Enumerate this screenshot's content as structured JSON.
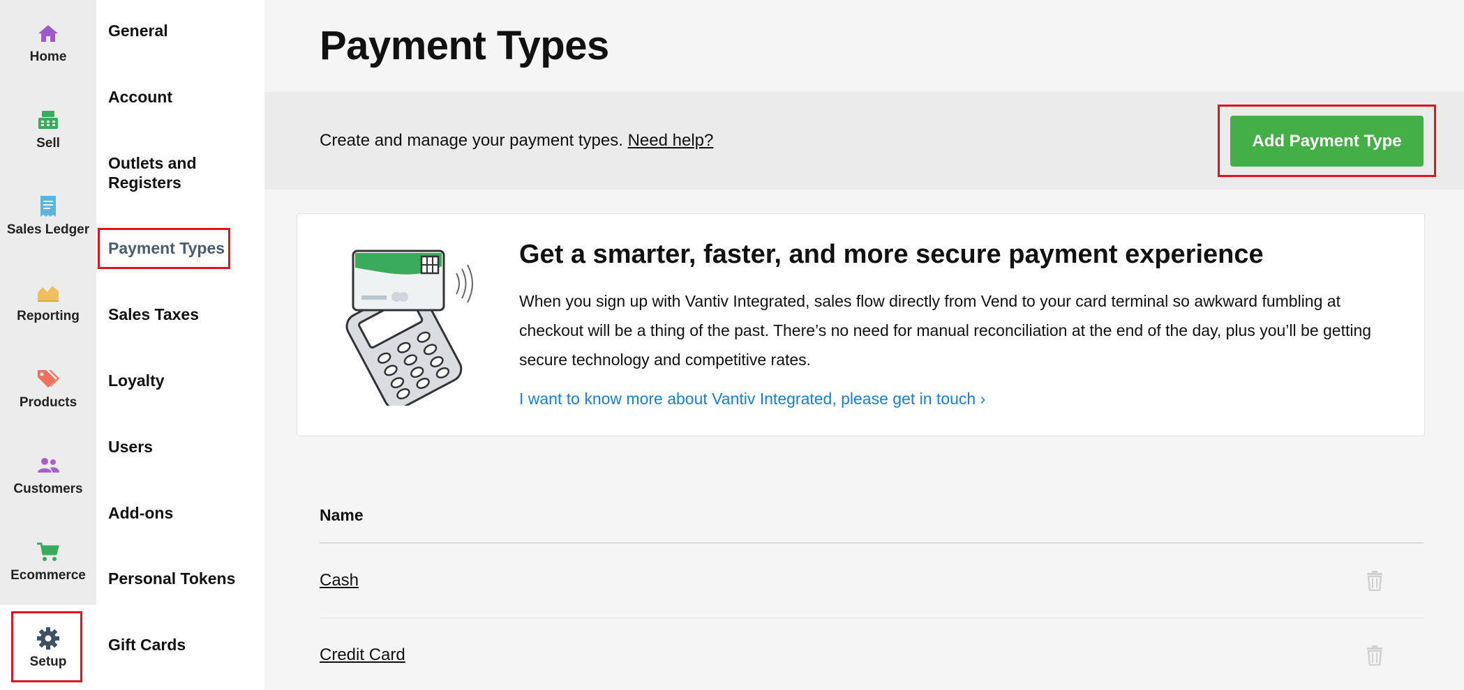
{
  "rail": {
    "items": [
      {
        "label": "Home",
        "icon": "home-icon"
      },
      {
        "label": "Sell",
        "icon": "register-icon"
      },
      {
        "label": "Sales Ledger",
        "icon": "receipt-icon"
      },
      {
        "label": "Reporting",
        "icon": "chart-icon"
      },
      {
        "label": "Products",
        "icon": "tags-icon"
      },
      {
        "label": "Customers",
        "icon": "people-icon"
      },
      {
        "label": "Ecommerce",
        "icon": "cart-icon"
      },
      {
        "label": "Setup",
        "icon": "gear-icon"
      }
    ],
    "active": "Setup"
  },
  "menu": {
    "items": [
      {
        "label": "General"
      },
      {
        "label": "Account"
      },
      {
        "label": "Outlets and Registers"
      },
      {
        "label": "Payment Types"
      },
      {
        "label": "Sales Taxes"
      },
      {
        "label": "Loyalty"
      },
      {
        "label": "Users"
      },
      {
        "label": "Add-ons"
      },
      {
        "label": "Personal Tokens"
      },
      {
        "label": "Gift Cards"
      }
    ],
    "active": "Payment Types"
  },
  "page": {
    "title": "Payment Types",
    "intro": "Create and manage your payment types. ",
    "help_link": "Need help?",
    "add_button": "Add Payment Type"
  },
  "promo": {
    "title": "Get a smarter, faster, and more secure payment experience",
    "body": "When you sign up with Vantiv Integrated, sales flow directly from Vend to your card terminal so awkward fumbling at checkout will be a thing of the past. There’s no need for manual reconciliation at the end of the day, plus you’ll be getting secure technology and competitive rates.",
    "link": "I want to know more about Vantiv Integrated, please get in touch ›"
  },
  "table": {
    "header": "Name",
    "rows": [
      {
        "name": "Cash"
      },
      {
        "name": "Credit Card"
      }
    ]
  },
  "colors": {
    "accent_green": "#44ae47",
    "link_blue": "#1a7dd8",
    "highlight_red": "#e0141e"
  }
}
